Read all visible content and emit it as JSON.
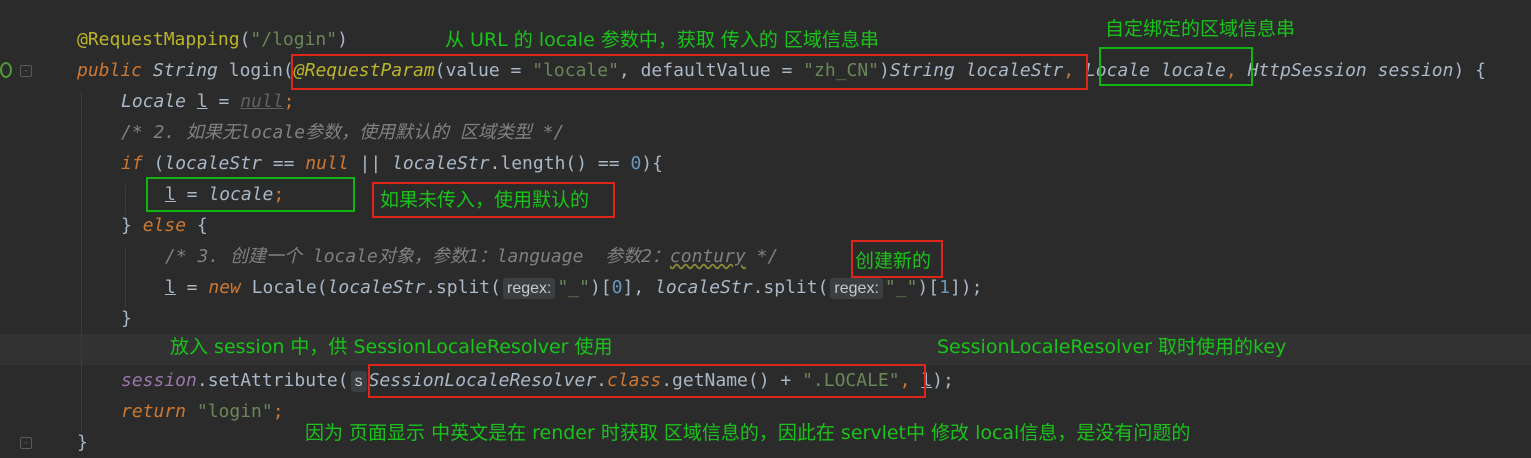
{
  "code": {
    "l1": {
      "annotation": "@RequestMapping",
      "paren_open": "(",
      "path": "\"/login\"",
      "paren_close": ")"
    },
    "l2": {
      "public": "public",
      "type_string": "String",
      "method": "login(",
      "req_param": "@RequestParam",
      "args_open": "(value = ",
      "value": "\"locale\"",
      "mid": ", defaultValue = ",
      "default": "\"zh_CN\"",
      "args_close": ")",
      "type_string2": "String",
      "param1": "localeStr",
      "comma1": ",",
      "type_locale": "Locale",
      "param2": "locale",
      "comma2": ",",
      "type_session": "HttpSession",
      "param3": "session",
      "tail": ") {"
    },
    "l3": {
      "type": "Locale",
      "var": "l",
      "eq": " = ",
      "val": "null",
      "semi": ";"
    },
    "l4": {
      "comment": "/* 2. 如果无locale参数，使用默认的 区域类型 */"
    },
    "l5": {
      "kw_if": "if",
      "open": " (",
      "var1": "localeStr",
      "op1": " == ",
      "null": "null",
      "op2": " || ",
      "var2": "localeStr",
      "call": ".length() == ",
      "zero": "0",
      "close": "){"
    },
    "l6": {
      "var": "l",
      "eq": " = ",
      "val": "locale",
      "semi": ";"
    },
    "l7": {
      "brace": "} ",
      "kw_else": "else",
      "tail": " {"
    },
    "l8": {
      "comment_a": "/* 3. 创建一个 locale对象，参数1：language  参数2：",
      "comment_word": "contury",
      "comment_b": " */"
    },
    "l9": {
      "var": "l",
      "eq": " = ",
      "kw_new": "new",
      "ctor": " Locale(",
      "a1": "localeStr",
      "split1": ".split(",
      "hint1": "regex:",
      "s1": "\"_\"",
      "idx0": ")[",
      "n0": "0",
      "mid": "], ",
      "a2": "localeStr",
      "split2": ".split(",
      "hint2": "regex:",
      "s2": "\"_\"",
      "idx1": ")[",
      "n1": "1",
      "end": "]);"
    },
    "l10": {
      "brace": "}"
    },
    "l12": {
      "obj": "session",
      "call": ".setAttribute(",
      "hint": "s",
      "cls": "SessionLocaleResolver",
      "dot": ".",
      "kw_class": "class",
      "getname": ".getName() + ",
      "str": "\".LOCALE\"",
      "comma": ", ",
      "var": "l",
      "end": ");"
    },
    "l13": {
      "kw_return": "return",
      "sp": " ",
      "str": "\"login\"",
      "semi": ";"
    },
    "l14": {
      "brace": "}"
    }
  },
  "notes": {
    "n1": "从 URL 的 locale 参数中，获取 传入的 区域信息串",
    "n2": "自定绑定的区域信息串",
    "n3": "如果未传入，使用默认的",
    "n4": "创建新的",
    "n5": "放入 session 中，供 SessionLocaleResolver 使用",
    "n6": "SessionLocaleResolver 取时使用的key",
    "n7": "因为 页面显示 中英文是在 render 时获取 区域信息的，因此在 servlet中 修改 local信息，是没有问题的"
  },
  "colors": {
    "background": "#2b2b2b",
    "keyword": "#cc7832",
    "string": "#6a8759",
    "annotation": "#bbb529",
    "number": "#6897bb",
    "highlight_red": "#e0251b",
    "highlight_green": "#13b313",
    "note_text": "#19c319"
  }
}
